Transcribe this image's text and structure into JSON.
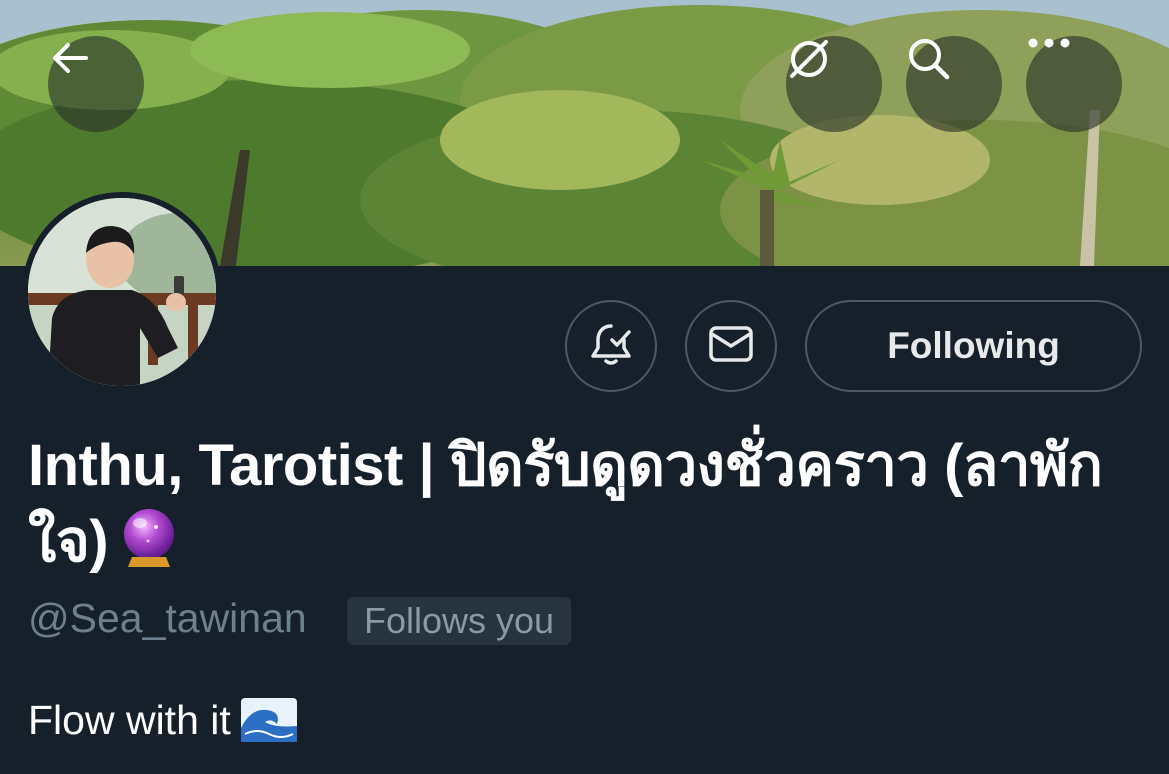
{
  "profile": {
    "display_name": "Inthu, Tarotist | ปิดรับดูดวงชั่วคราว (ลาพักใจ)",
    "display_name_emoji": "crystal-ball",
    "handle": "@Sea_tawinan",
    "follows_you_label": "Follows you",
    "bio": "Flow with it",
    "bio_emoji": "water-wave"
  },
  "header": {
    "back_icon": "arrow-left-icon",
    "grok_icon": "grok-slash-icon",
    "search_icon": "search-icon",
    "more_icon": "more-horizontal-icon"
  },
  "actions": {
    "notify_icon": "bell-check-icon",
    "message_icon": "envelope-icon",
    "following_label": "Following"
  },
  "colors": {
    "background": "#15202b",
    "button_border": "#4a5a68",
    "handle_text": "#6e7f8d",
    "badge_bg": "#283340"
  }
}
